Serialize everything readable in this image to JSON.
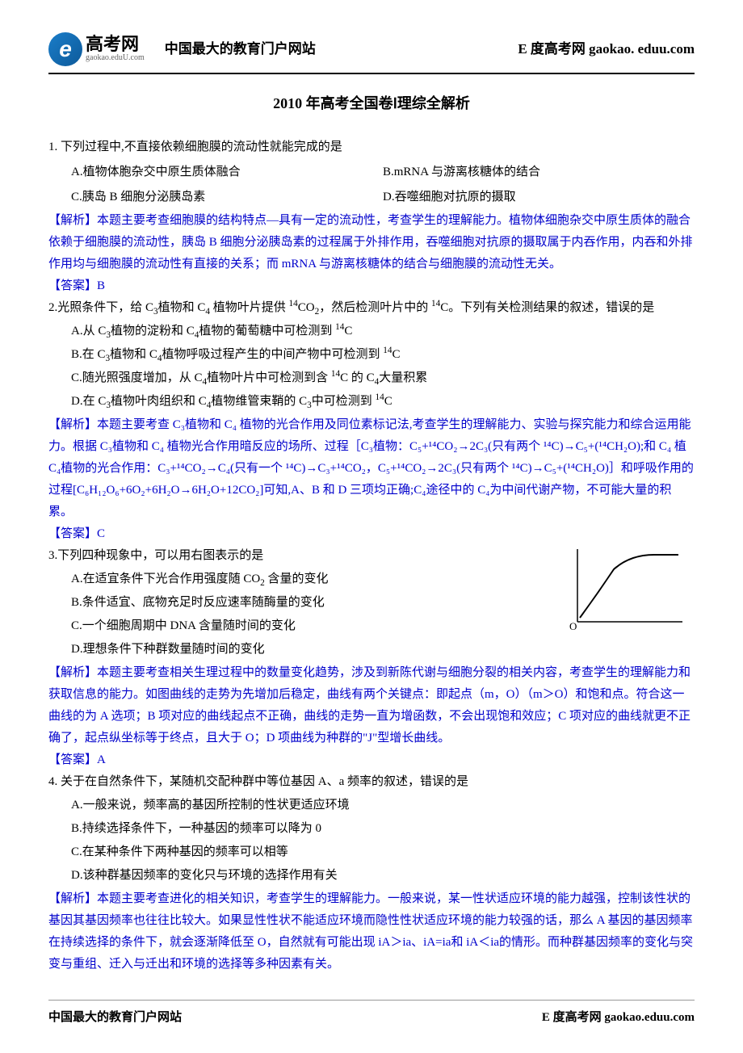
{
  "header": {
    "logo_letter": "e",
    "logo_main": "高考网",
    "logo_sub": "gaokao.eduU.com",
    "title_left": "中国最大的教育门户网站",
    "title_right": "E 度高考网 gaokao. eduu.com"
  },
  "doc_title": "2010 年高考全国卷Ⅰ理综全解析",
  "q1": {
    "stem": "1. 下列过程中,不直接依赖细胞膜的流动性就能完成的是",
    "optA": "A.植物体胞杂交中原生质体融合",
    "optB": "B.mRNA 与游离核糖体的结合",
    "optC": "C.胰岛 B 细胞分泌胰岛素",
    "optD": "D.吞噬细胞对抗原的摄取",
    "explain": "【解析】本题主要考查细胞膜的结构特点—具有一定的流动性，考查学生的理解能力。植物体细胞杂交中原生质体的融合依赖于细胞膜的流动性，胰岛 B 细胞分泌胰岛素的过程属于外排作用，吞噬细胞对抗原的摄取属于内吞作用，内吞和外排作用均与细胞膜的流动性有直接的关系；而 mRNA 与游离核糖体的结合与细胞膜的流动性无关。",
    "answer": "【答案】B"
  },
  "q2": {
    "stem_a": "2.光照条件下，给 C",
    "stem_b": "植物和 C",
    "stem_c": " 植物叶片提供 ",
    "stem_d": "CO",
    "stem_e": "，然后检测叶片中的 ",
    "stem_f": "C。下列有关检测结果的叙述，错误的是",
    "optA_a": "A.从 C",
    "optA_b": "植物的淀粉和 C",
    "optA_c": "植物的葡萄糖中可检测到 ",
    "optA_d": "C",
    "optB_a": "B.在 C",
    "optB_b": "植物和 C",
    "optB_c": "植物呼吸过程产生的中间产物中可检测到 ",
    "optB_d": "C",
    "optC_a": "C.随光照强度增加，从 C",
    "optC_b": "植物叶片中可检测到含 ",
    "optC_c": "C 的 C",
    "optC_d": "大量积累",
    "optD_a": "D.在 C",
    "optD_b": "植物叶肉组织和 C",
    "optD_c": "植物维管束鞘的 C",
    "optD_d": "中可检测到 ",
    "optD_e": "C",
    "explain": "【解析】本题主要考查 C₃植物和 C₄ 植物的光合作用及同位素标记法,考查学生的理解能力、实验与探究能力和综合运用能力。根据 C₃植物和 C₄ 植物光合作用暗反应的场所、过程［C₃植物：C₅+¹⁴CO₂→2C₃(只有两个 ¹⁴C)→C₅+(¹⁴CH₂O);和 C₄ 植 C₄植物的光合作用：C₃+¹⁴CO₂→C₄(只有一个 ¹⁴C)→C₃+¹⁴CO₂，C₅+¹⁴CO₂→2C₃(只有两个 ¹⁴C)→C₅+(¹⁴CH₂O)］和呼吸作用的过程[C₆H₁₂O₆+6O₂+6H₂O→6H₂O+12CO₂]可知,A、B 和 D 三项均正确;C₄途径中的 C₄为中间代谢产物，不可能大量的积累。",
    "answer": "【答案】C"
  },
  "q3": {
    "stem": "3.下列四种现象中，可以用右图表示的是",
    "optA_a": "A.在适宜条件下光合作用强度随 CO",
    "optA_b": " 含量的变化",
    "optB": "B.条件适宜、底物充足时反应速率随酶量的变化",
    "optC": "C.一个细胞周期中 DNA 含量随时间的变化",
    "optD": "D.理想条件下种群数量随时间的变化",
    "axis_o": "O",
    "explain": "【解析】本题主要考查相关生理过程中的数量变化趋势，涉及到新陈代谢与细胞分裂的相关内容，考查学生的理解能力和获取信息的能力。如图曲线的走势为先增加后稳定，曲线有两个关键点：即起点（m，O）（m＞O）和饱和点。符合这一曲线的为 A 选项；B 项对应的曲线起点不正确，曲线的走势一直为增函数，不会出现饱和效应；C 项对应的曲线就更不正确了，起点纵坐标等于终点，且大于 O；D 项曲线为种群的\"J\"型增长曲线。",
    "answer": "【答案】A"
  },
  "q4": {
    "stem": "4. 关于在自然条件下，某随机交配种群中等位基因 A、a 频率的叙述，错误的是",
    "optA": "A.一般来说，频率高的基因所控制的性状更适应环境",
    "optB": "B.持续选择条件下，一种基因的频率可以降为 0",
    "optC": "C.在某种条件下两种基因的频率可以相等",
    "optD": "D.该种群基因频率的变化只与环境的选择作用有关",
    "explain": "【解析】本题主要考查进化的相关知识，考查学生的理解能力。一般来说，某一性状适应环境的能力越强，控制该性状的基因其基因频率也往往比较大。如果显性性状不能适应环境而隐性性状适应环境的能力较强的话，那么 A 基因的基因频率在持续选择的条件下，就会逐渐降低至 O，自然就有可能出现 iA＞ia、iA=ia和 iA＜ia的情形。而种群基因频率的变化与突变与重组、迁入与迁出和环境的选择等多种因素有关。"
  },
  "footer": {
    "left": "中国最大的教育门户网站",
    "right": "E 度高考网 gaokao.eduu.com"
  }
}
